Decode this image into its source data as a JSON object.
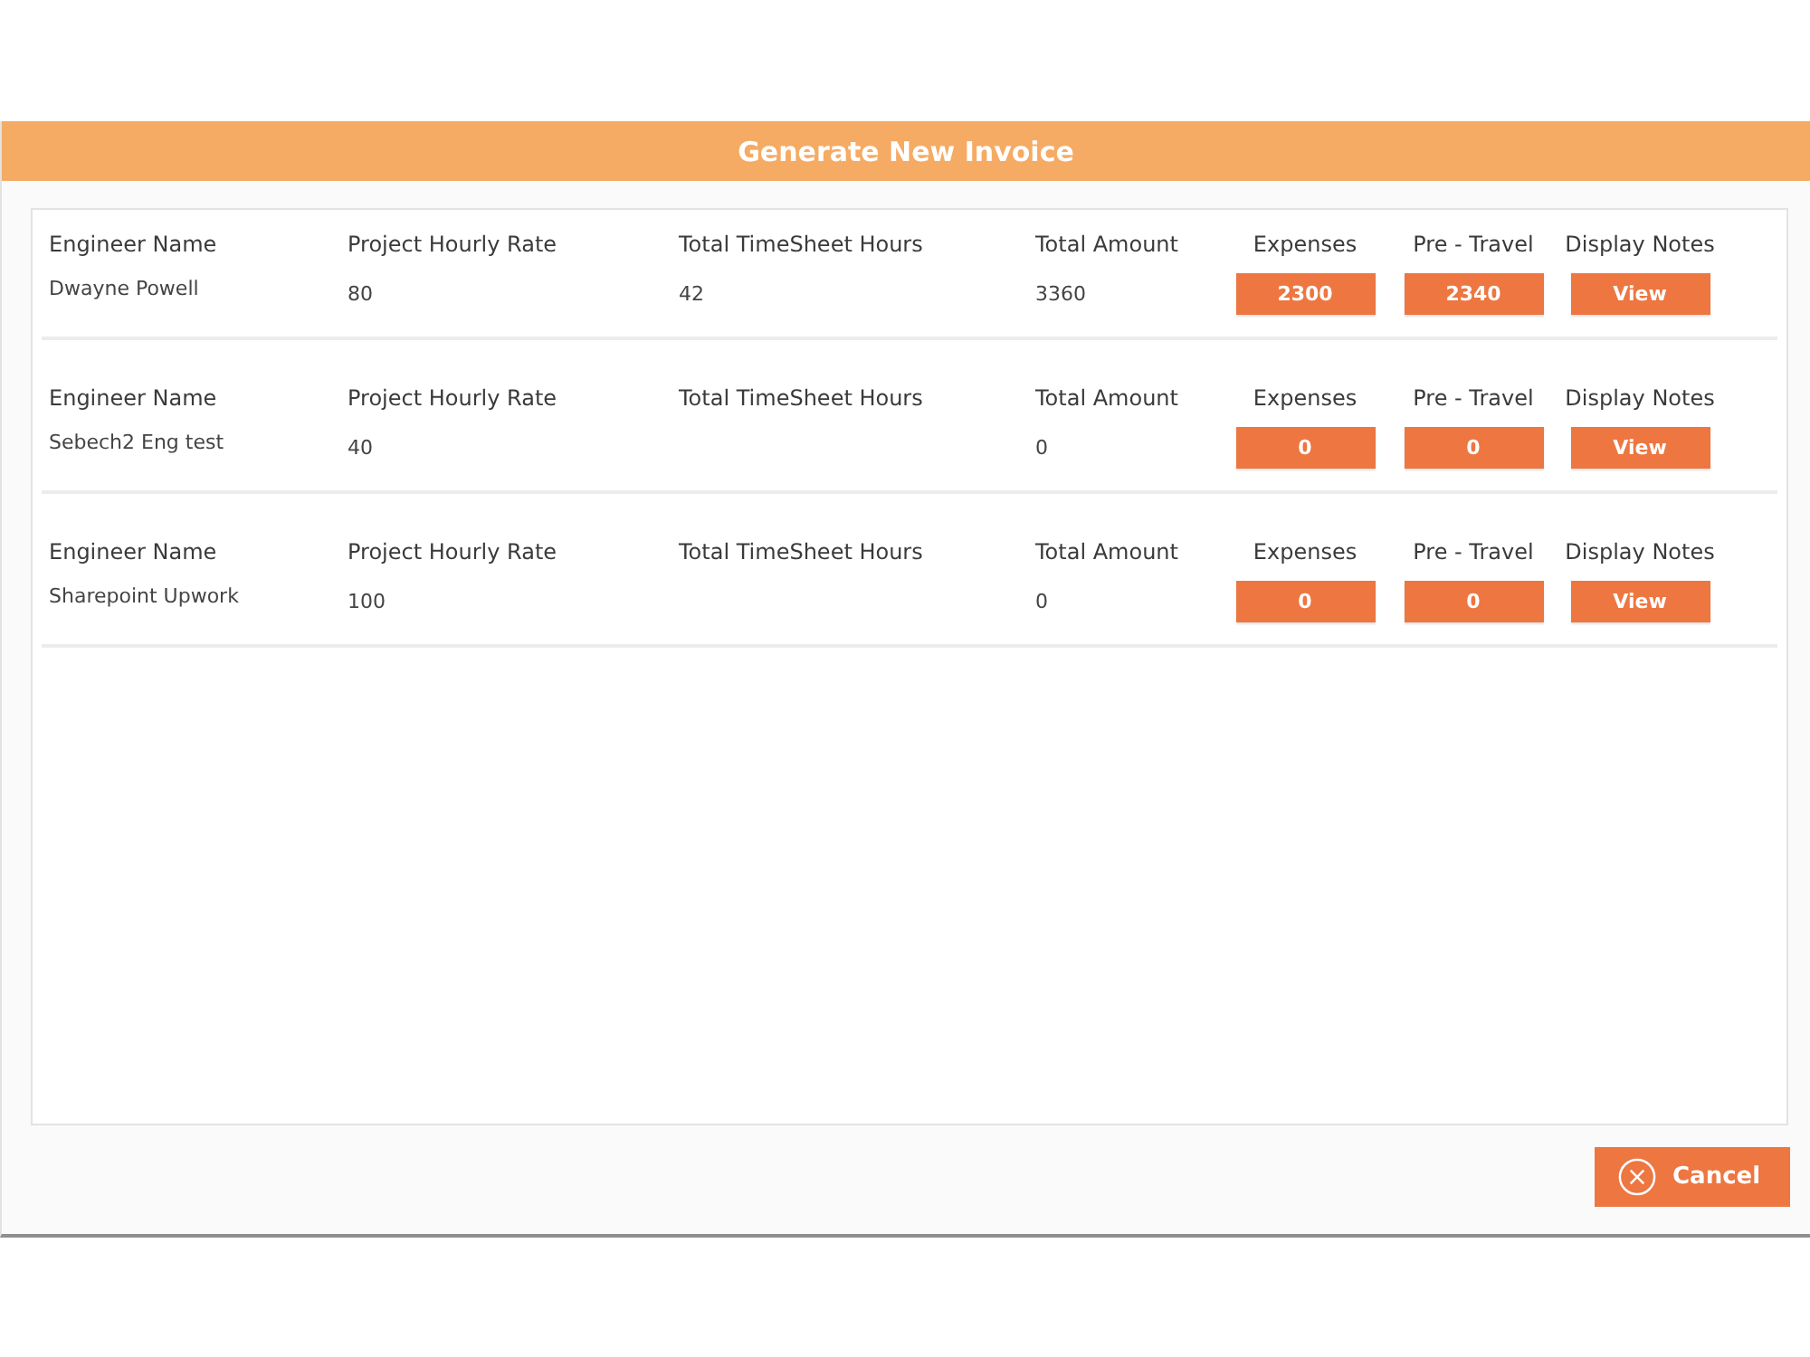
{
  "dialog": {
    "title": "Generate New Invoice"
  },
  "rows": [
    {
      "cells": [
        {
          "kind": "text",
          "label": "Engineer Name",
          "value": "Dwayne Powell"
        },
        {
          "kind": "text",
          "label": "Project Hourly Rate",
          "value": "80"
        },
        {
          "kind": "text",
          "label": "Total TimeSheet Hours",
          "value": "42"
        },
        {
          "kind": "text",
          "label": "Total Amount",
          "value": "3360"
        },
        {
          "kind": "button",
          "label": "Expenses",
          "value": "2300"
        },
        {
          "kind": "button",
          "label": "Pre - Travel",
          "value": "2340"
        },
        {
          "kind": "button",
          "label": "Display Notes",
          "value": "View"
        }
      ]
    },
    {
      "cells": [
        {
          "kind": "text",
          "label": "Engineer Name",
          "value": "Sebech2 Eng test"
        },
        {
          "kind": "text",
          "label": "Project Hourly Rate",
          "value": "40"
        },
        {
          "kind": "text",
          "label": "Total TimeSheet Hours"
        },
        {
          "kind": "text",
          "label": "Total Amount",
          "value": "0"
        },
        {
          "kind": "button",
          "label": "Expenses",
          "value": "0"
        },
        {
          "kind": "button",
          "label": "Pre - Travel",
          "value": "0"
        },
        {
          "kind": "button",
          "label": "Display Notes",
          "value": "View"
        }
      ]
    },
    {
      "cells": [
        {
          "kind": "text",
          "label": "Engineer Name",
          "value": "Sharepoint Upwork"
        },
        {
          "kind": "text",
          "label": "Project Hourly Rate",
          "value": "100"
        },
        {
          "kind": "text",
          "label": "Total TimeSheet Hours"
        },
        {
          "kind": "text",
          "label": "Total Amount",
          "value": "0"
        },
        {
          "kind": "button",
          "label": "Expenses",
          "value": "0"
        },
        {
          "kind": "button",
          "label": "Pre - Travel",
          "value": "0"
        },
        {
          "kind": "button",
          "label": "Display Notes",
          "value": "View"
        }
      ]
    }
  ],
  "footer": {
    "cancel_button": "Cancel"
  }
}
